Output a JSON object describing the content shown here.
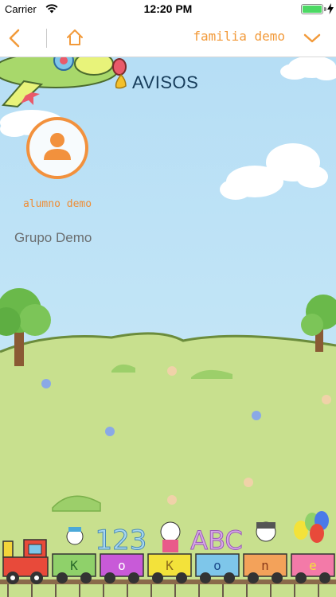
{
  "status_bar": {
    "carrier": "Carrier",
    "time": "12:20 PM",
    "battery_level": 1.0
  },
  "nav": {
    "back_icon": "chevron-left-icon",
    "home_icon": "home-icon",
    "family_label": "familia demo",
    "dropdown_icon": "chevron-down-icon",
    "accent_color": "#f29a3a"
  },
  "main": {
    "section_title": "AVISOS",
    "student_name": "alumno demo",
    "group_name": "Grupo Demo",
    "avatar_icon": "user-icon",
    "avatar_color": "#f2913d"
  },
  "decoration": {
    "train_car_letters": [
      "K",
      "o",
      "K",
      "o",
      "n",
      "e"
    ],
    "train_top_signs": [
      "123",
      "ABC"
    ]
  }
}
